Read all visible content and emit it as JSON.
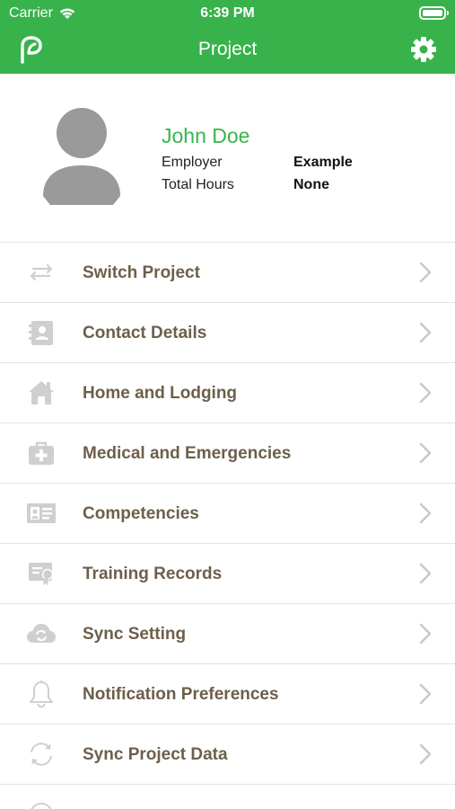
{
  "status_bar": {
    "carrier": "Carrier",
    "time": "6:39 PM",
    "icons": [
      "wifi-icon",
      "battery-icon"
    ]
  },
  "nav": {
    "title": "Project",
    "left_icon": "app-logo-icon",
    "right_icon": "gear-icon"
  },
  "profile": {
    "name": "John Doe",
    "rows": [
      {
        "label": "Employer",
        "value": "Example"
      },
      {
        "label": "Total Hours",
        "value": "None"
      }
    ]
  },
  "menu": {
    "items": [
      {
        "label": "Switch Project",
        "icon": "swap-arrows-icon"
      },
      {
        "label": "Contact Details",
        "icon": "contact-book-icon"
      },
      {
        "label": "Home and Lodging",
        "icon": "house-icon"
      },
      {
        "label": "Medical and Emergencies",
        "icon": "medical-kit-icon"
      },
      {
        "label": "Competencies",
        "icon": "id-card-icon"
      },
      {
        "label": "Training Records",
        "icon": "certificate-icon"
      },
      {
        "label": "Sync Setting",
        "icon": "cloud-sync-icon"
      },
      {
        "label": "Notification Preferences",
        "icon": "bell-icon"
      },
      {
        "label": "Sync Project Data",
        "icon": "refresh-icon"
      }
    ]
  },
  "colors": {
    "header": "#38b24a",
    "name_green": "#3bb44e",
    "menu_text": "#6d5f4a",
    "icon_gray": "#c8c8c8"
  }
}
